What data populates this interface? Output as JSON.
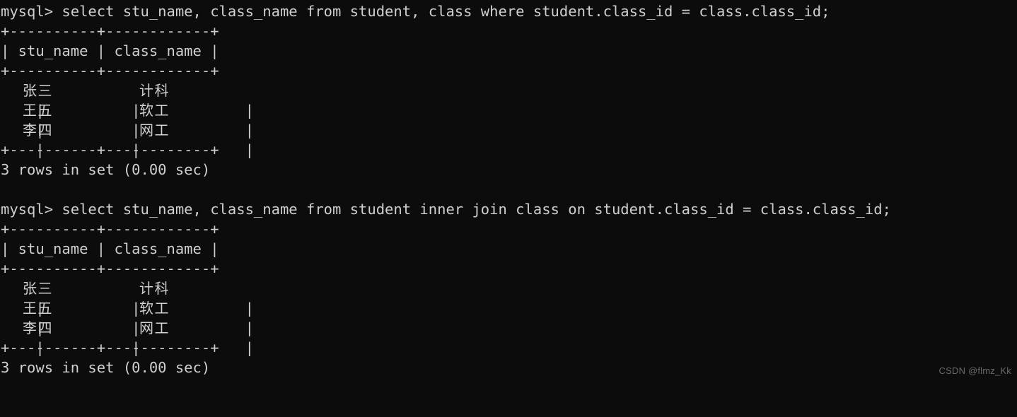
{
  "terminal": {
    "prompt": "mysql> ",
    "background_color": "#0c0c0c",
    "text_color": "#cfcfcf",
    "blocks": [
      {
        "command_line": "mysql> select stu_name, class_name from student, class where student.class_id = class.class_id;",
        "command": "select stu_name, class_name from student, class where student.class_id = class.class_id;",
        "separator_top": "+----------+------------+",
        "header_line": "| stu_name | class_name |",
        "separator_mid": "+----------+------------+",
        "rows": [
          {
            "frame": "|          |            |",
            "stu_name": "张三",
            "class_name": "计科"
          },
          {
            "frame": "|          |            |",
            "stu_name": "王五",
            "class_name": "软工"
          },
          {
            "frame": "|          |            |",
            "stu_name": "李四",
            "class_name": "网工"
          }
        ],
        "separator_bottom": "+----------+------------+",
        "status": "3 rows in set (0.00 sec)"
      },
      {
        "command_line": "mysql> select stu_name, class_name from student inner join class on student.class_id = class.class_id;",
        "command": "select stu_name, class_name from student inner join class on student.class_id = class.class_id;",
        "separator_top": "+----------+------------+",
        "header_line": "| stu_name | class_name |",
        "separator_mid": "+----------+------------+",
        "rows": [
          {
            "frame": "|          |            |",
            "stu_name": "张三",
            "class_name": "计科"
          },
          {
            "frame": "|          |            |",
            "stu_name": "王五",
            "class_name": "软工"
          },
          {
            "frame": "|          |            |",
            "stu_name": "李四",
            "class_name": "网工"
          }
        ],
        "separator_bottom": "+----------+------------+",
        "status": "3 rows in set (0.00 sec)"
      }
    ],
    "columns": [
      "stu_name",
      "class_name"
    ],
    "blank_line": " "
  },
  "watermark": {
    "text": "CSDN @flmz_Kk"
  }
}
